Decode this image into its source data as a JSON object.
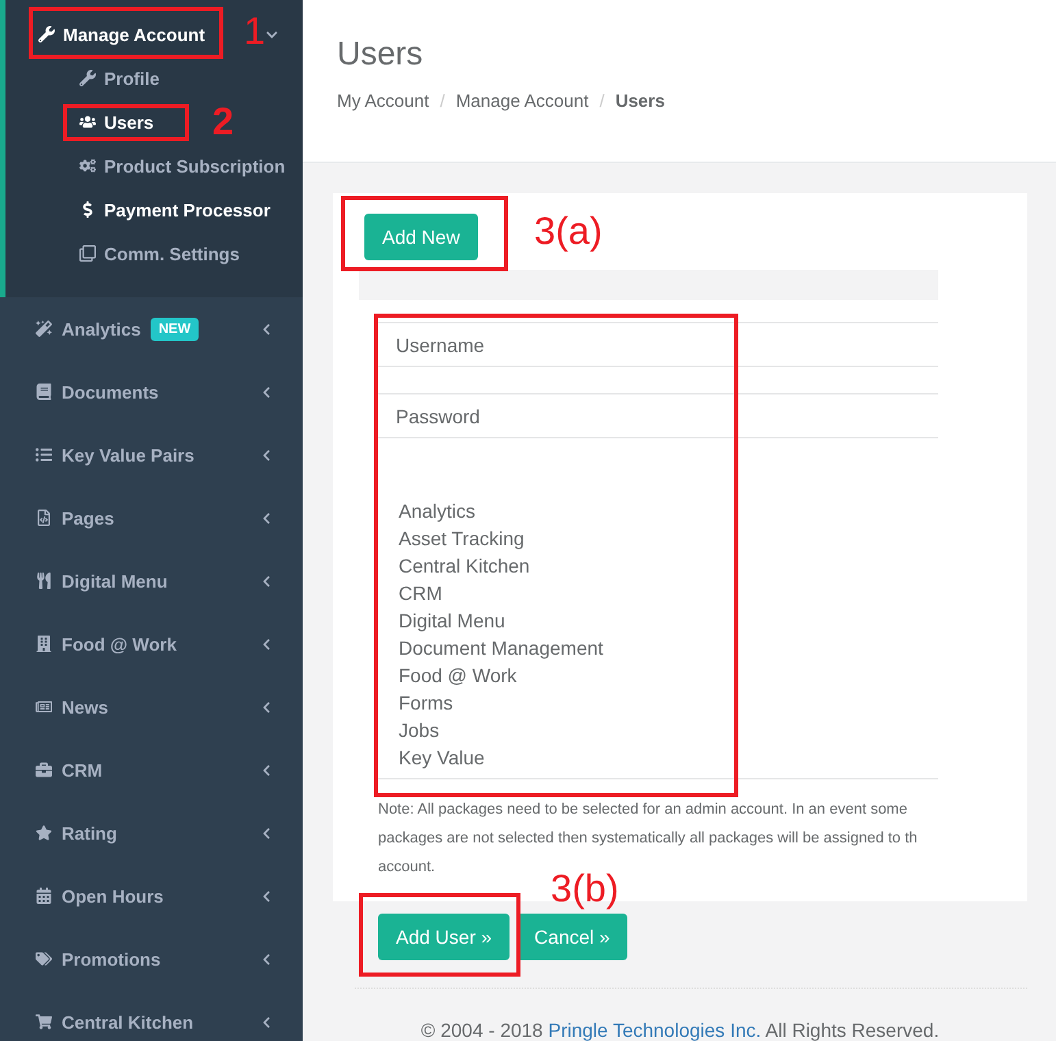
{
  "sidebar": {
    "header": {
      "label": "Manage Account",
      "expanded": true,
      "annotation": "1"
    },
    "sub_items": [
      {
        "label": "Profile",
        "selected": false
      },
      {
        "label": "Users",
        "selected": true,
        "annotation": "2"
      },
      {
        "label": "Product Subscription",
        "selected": false
      },
      {
        "label": "Payment Processor",
        "selected": true
      },
      {
        "label": "Comm. Settings",
        "selected": false
      }
    ],
    "items": [
      {
        "label": "Analytics",
        "badge": "NEW",
        "expanded": false
      },
      {
        "label": "Documents",
        "expanded": false
      },
      {
        "label": "Key Value Pairs",
        "expanded": false
      },
      {
        "label": "Pages",
        "expanded": false
      },
      {
        "label": "Digital Menu",
        "expanded": false
      },
      {
        "label": "Food @ Work",
        "expanded": false
      },
      {
        "label": "News",
        "expanded": false
      },
      {
        "label": "CRM",
        "expanded": false
      },
      {
        "label": "Rating",
        "expanded": false
      },
      {
        "label": "Open Hours",
        "expanded": false
      },
      {
        "label": "Promotions",
        "expanded": false
      },
      {
        "label": "Central Kitchen",
        "expanded": false
      }
    ]
  },
  "page": {
    "title": "Users",
    "breadcrumb": [
      "My Account",
      "Manage Account",
      "Users"
    ],
    "breadcrumb_separator": "/"
  },
  "form": {
    "add_new": {
      "label": "Add New",
      "annotation": "3(a)"
    },
    "fields_highlighted": true,
    "username": {
      "placeholder": "Username"
    },
    "password": {
      "placeholder": "Password"
    },
    "packages": [
      "Analytics",
      "Asset Tracking",
      "Central Kitchen",
      "CRM",
      "Digital Menu",
      "Document Management",
      "Food @ Work",
      "Forms",
      "Jobs",
      "Key Value"
    ],
    "note": [
      "Note: All packages need to be selected for an admin account. In an event some",
      "packages are not selected then systematically all packages will be assigned to th",
      "account."
    ],
    "add_user": {
      "label": "Add User »",
      "annotation": "3(b)"
    },
    "cancel": {
      "label": "Cancel »"
    }
  },
  "footer": {
    "prefix": "© 2004 - 2018",
    "link": "Pringle Technologies Inc.",
    "suffix": "All Rights Reserved."
  }
}
